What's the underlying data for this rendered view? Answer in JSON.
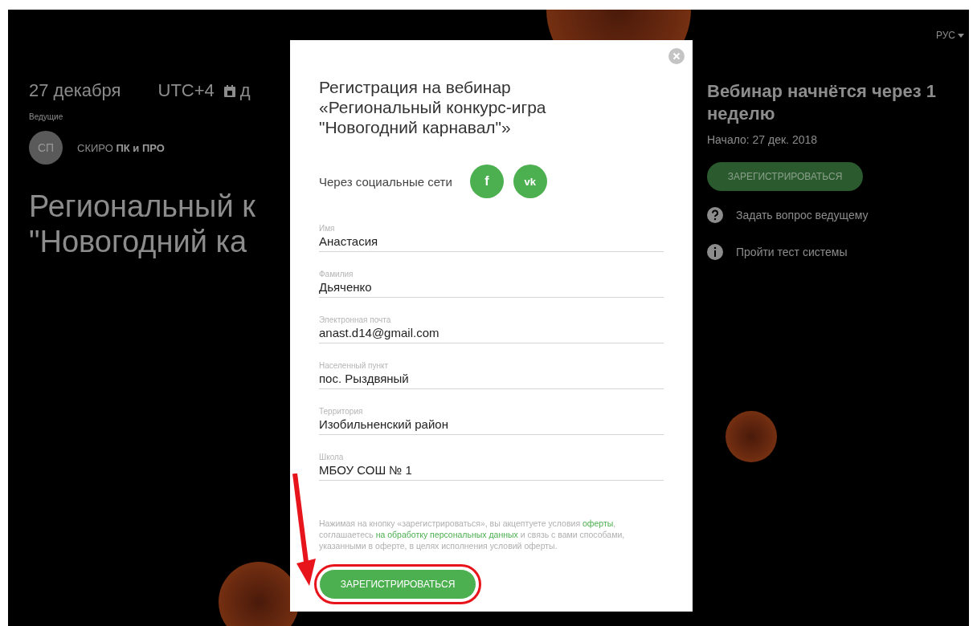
{
  "language": {
    "label": "РУС"
  },
  "event": {
    "date": "27 декабря",
    "timezone": "UTC+4",
    "calendar_text": "д",
    "hosts_label": "Ведущие",
    "host": {
      "initials": "СП",
      "name": "СКИРО **ПК и ПРО**"
    },
    "title_lines": [
      "Региональный к",
      "\"Новогодний ка"
    ]
  },
  "sidebar": {
    "countdown": "Вебинар начнётся через 1 неделю",
    "start": "Начало: 27 дек. 2018",
    "register_button": "ЗАРЕГИСТРИРОВАТЬСЯ",
    "links": [
      {
        "kind": "question",
        "label": "Задать вопрос ведущему"
      },
      {
        "kind": "info",
        "label": "Пройти тест системы"
      }
    ]
  },
  "modal": {
    "title": "Регистрация на вебинар «Региональный конкурс-игра \"Новогодний карнавал\"»",
    "social_label": "Через социальные сети",
    "social": [
      {
        "kind": "facebook",
        "label": "f"
      },
      {
        "kind": "vk",
        "label": "vk"
      }
    ],
    "fields": [
      {
        "label": "Имя",
        "value": "Анастасия"
      },
      {
        "label": "Фамилия",
        "value": "Дьяченко"
      },
      {
        "label": "Электронная почта",
        "value": "anast.d14@gmail.com"
      },
      {
        "label": "Населенный пункт",
        "value": "пос. Рыздвяный"
      },
      {
        "label": "Территория",
        "value": "Изобильненский район"
      },
      {
        "label": "Школа",
        "value": "МБОУ СОШ № 1"
      }
    ],
    "notice": [
      {
        "kind": "text",
        "text": "Нажимая на кнопку «зарегистрироваться», вы акцептуете условия "
      },
      {
        "kind": "link",
        "text": "оферты"
      },
      {
        "kind": "text",
        "text": ", соглашаетесь "
      },
      {
        "kind": "link",
        "text": "на обработку персональных данных"
      },
      {
        "kind": "text",
        "text": " и связь с вами способами, указанными в оферте, в целях исполнения условий оферты."
      }
    ],
    "submit_button": "ЗАРЕГИСТРИРОВАТЬСЯ",
    "submit_highlighted": true
  }
}
